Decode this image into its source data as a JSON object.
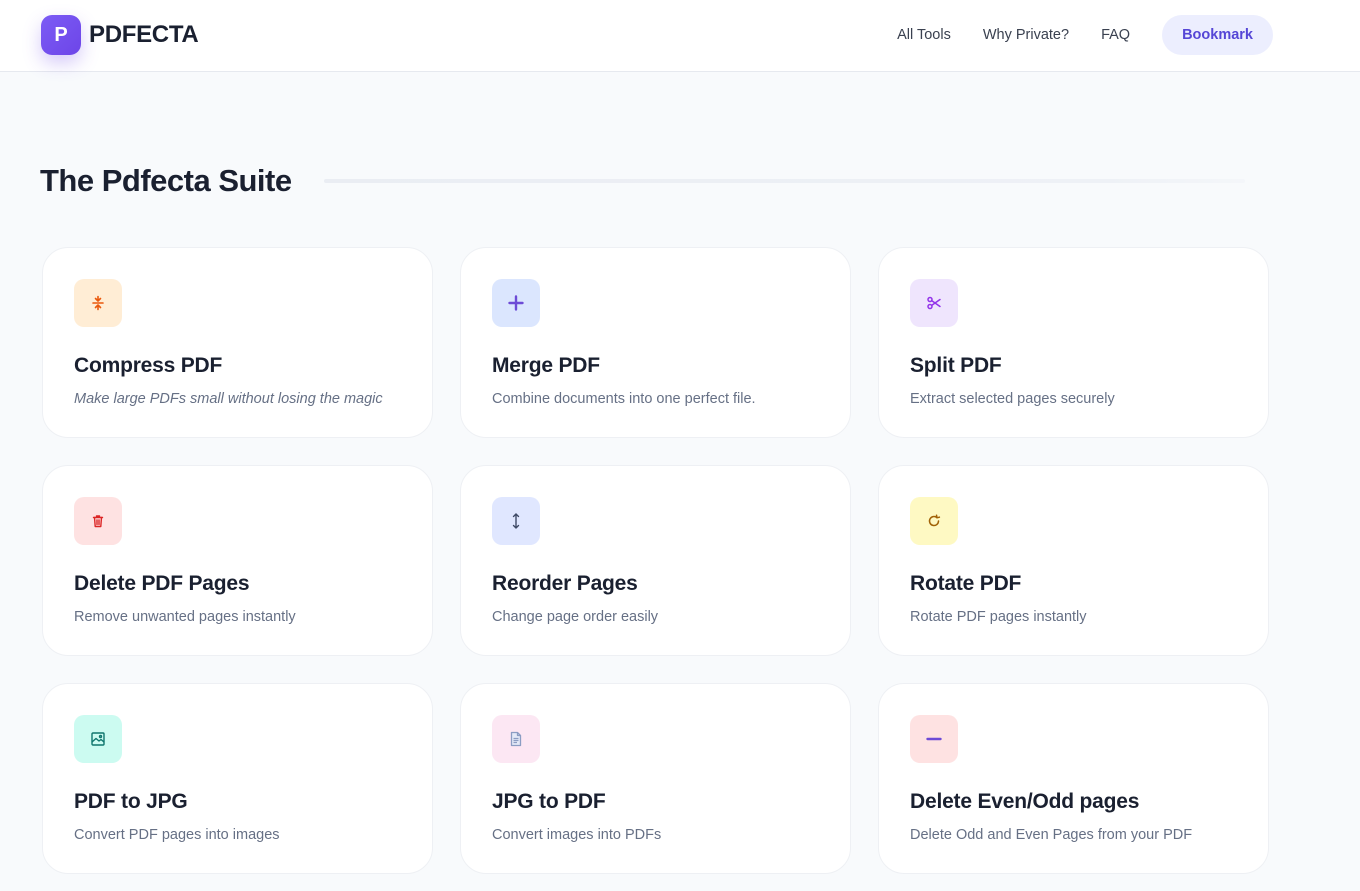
{
  "header": {
    "brand_letter": "P",
    "brand_name": "PDFECTA",
    "nav": {
      "all_tools": "All Tools",
      "why_private": "Why Private?",
      "faq": "FAQ",
      "bookmark": "Bookmark"
    }
  },
  "section": {
    "title": "The Pdfecta Suite"
  },
  "colors": {
    "brand": "#6d45e8",
    "bookmark_bg": "#eceefe",
    "bookmark_text": "#5546d6"
  },
  "tools": [
    {
      "title": "Compress PDF",
      "desc": "Make large PDFs small without losing the magic",
      "icon": "compress-icon",
      "icon_bg": "#ffedd5",
      "icon_color": "#ea580c"
    },
    {
      "title": "Merge PDF",
      "desc": "Combine documents into one perfect file.",
      "icon": "plus-icon",
      "icon_bg": "#dbe6fe",
      "icon_color": "#6d4bd6"
    },
    {
      "title": "Split PDF",
      "desc": "Extract selected pages securely",
      "icon": "scissors-icon",
      "icon_bg": "#efe5fd",
      "icon_color": "#9333ea"
    },
    {
      "title": "Delete PDF Pages",
      "desc": "Remove unwanted pages instantly",
      "icon": "trash-icon",
      "icon_bg": "#fee2e2",
      "icon_color": "#dc2626"
    },
    {
      "title": "Reorder Pages",
      "desc": "Change page order easily",
      "icon": "up-down-arrow-icon",
      "icon_bg": "#e0e7ff",
      "icon_color": "#3f4a66"
    },
    {
      "title": "Rotate PDF",
      "desc": "Rotate PDF pages instantly",
      "icon": "rotate-icon",
      "icon_bg": "#fef9c3",
      "icon_color": "#a16207"
    },
    {
      "title": "PDF to JPG",
      "desc": "Convert PDF pages into images",
      "icon": "image-icon",
      "icon_bg": "#ccfbf1",
      "icon_color": "#0f766e"
    },
    {
      "title": "JPG to PDF",
      "desc": "Convert images into PDFs",
      "icon": "document-icon",
      "icon_bg": "#fce7f3",
      "icon_color": "#8b9dc3"
    },
    {
      "title": "Delete Even/Odd pages",
      "desc": "Delete Odd and Even Pages from your PDF",
      "icon": "minus-icon",
      "icon_bg": "#fee2e2",
      "icon_color": "#6d4bd6"
    }
  ]
}
